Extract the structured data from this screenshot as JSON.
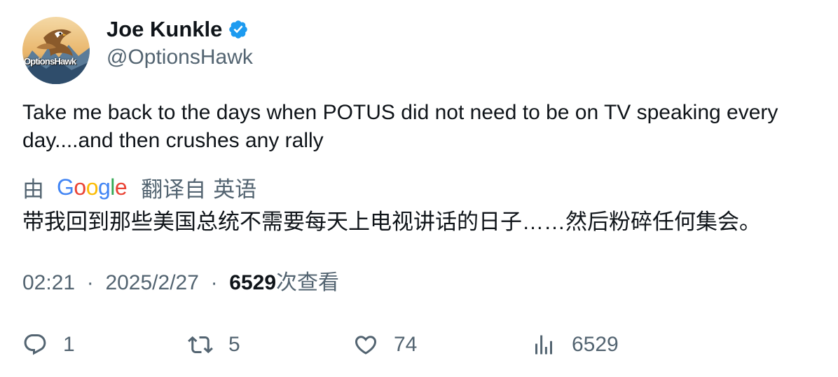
{
  "tweet": {
    "author": {
      "name": "Joe Kunkle",
      "handle": "@OptionsHawk",
      "verified": true,
      "avatar_text": "OptionsHawk"
    },
    "text": "Take me back to the days when POTUS did not need to be on TV speaking every day....and then crushes any rally",
    "translation": {
      "by_label": "由",
      "provider": "Google",
      "from_label": "翻译自",
      "language": "英语",
      "text": "带我回到那些美国总统不需要每天上电视讲话的日子……然后粉碎任何集会。"
    },
    "meta": {
      "time": "02:21",
      "separator": "·",
      "date": "2025/2/27",
      "views_count": "6529",
      "views_label": "次查看"
    },
    "actions": {
      "replies": "1",
      "retweets": "5",
      "likes": "74",
      "views": "6529"
    }
  },
  "colors": {
    "text_primary": "#0f1419",
    "text_secondary": "#536471",
    "verified_blue": "#1d9bf0",
    "google_blue": "#4285F4",
    "google_red": "#EA4335",
    "google_yellow": "#FBBC05",
    "google_green": "#34A853"
  },
  "icons": {
    "verified": "verified-badge-icon",
    "reply": "reply-icon",
    "retweet": "retweet-icon",
    "like": "heart-icon",
    "views": "analytics-icon"
  }
}
